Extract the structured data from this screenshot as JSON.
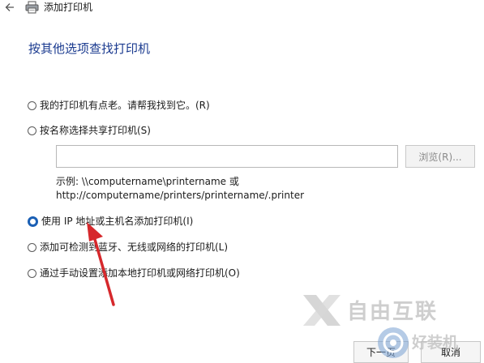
{
  "window": {
    "title": "添加打印机"
  },
  "heading": "按其他选项查找打印机",
  "options": [
    {
      "label": "我的打印机有点老。请帮我找到它。(R)",
      "checked": false
    },
    {
      "label": "按名称选择共享打印机(S)",
      "checked": false
    },
    {
      "label": "使用 IP 地址或主机名添加打印机(I)",
      "checked": true
    },
    {
      "label": "添加可检测到蓝牙、无线或网络的打印机(L)",
      "checked": false
    },
    {
      "label": "通过手动设置添加本地打印机或网络打印机(O)",
      "checked": false
    }
  ],
  "share_name": {
    "value": "",
    "browse_label": "浏览(R)...",
    "example_line1": "示例: \\\\computername\\printername 或",
    "example_line2": "http://computername/printers/printername/.printer"
  },
  "buttons": {
    "next": "下一页",
    "cancel": "取消"
  },
  "watermark": {
    "line1": "自由互联",
    "line2": "好装机"
  },
  "colors": {
    "heading": "#1a3a8f",
    "accent": "#1a5fb4",
    "arrow": "#d6282c"
  }
}
